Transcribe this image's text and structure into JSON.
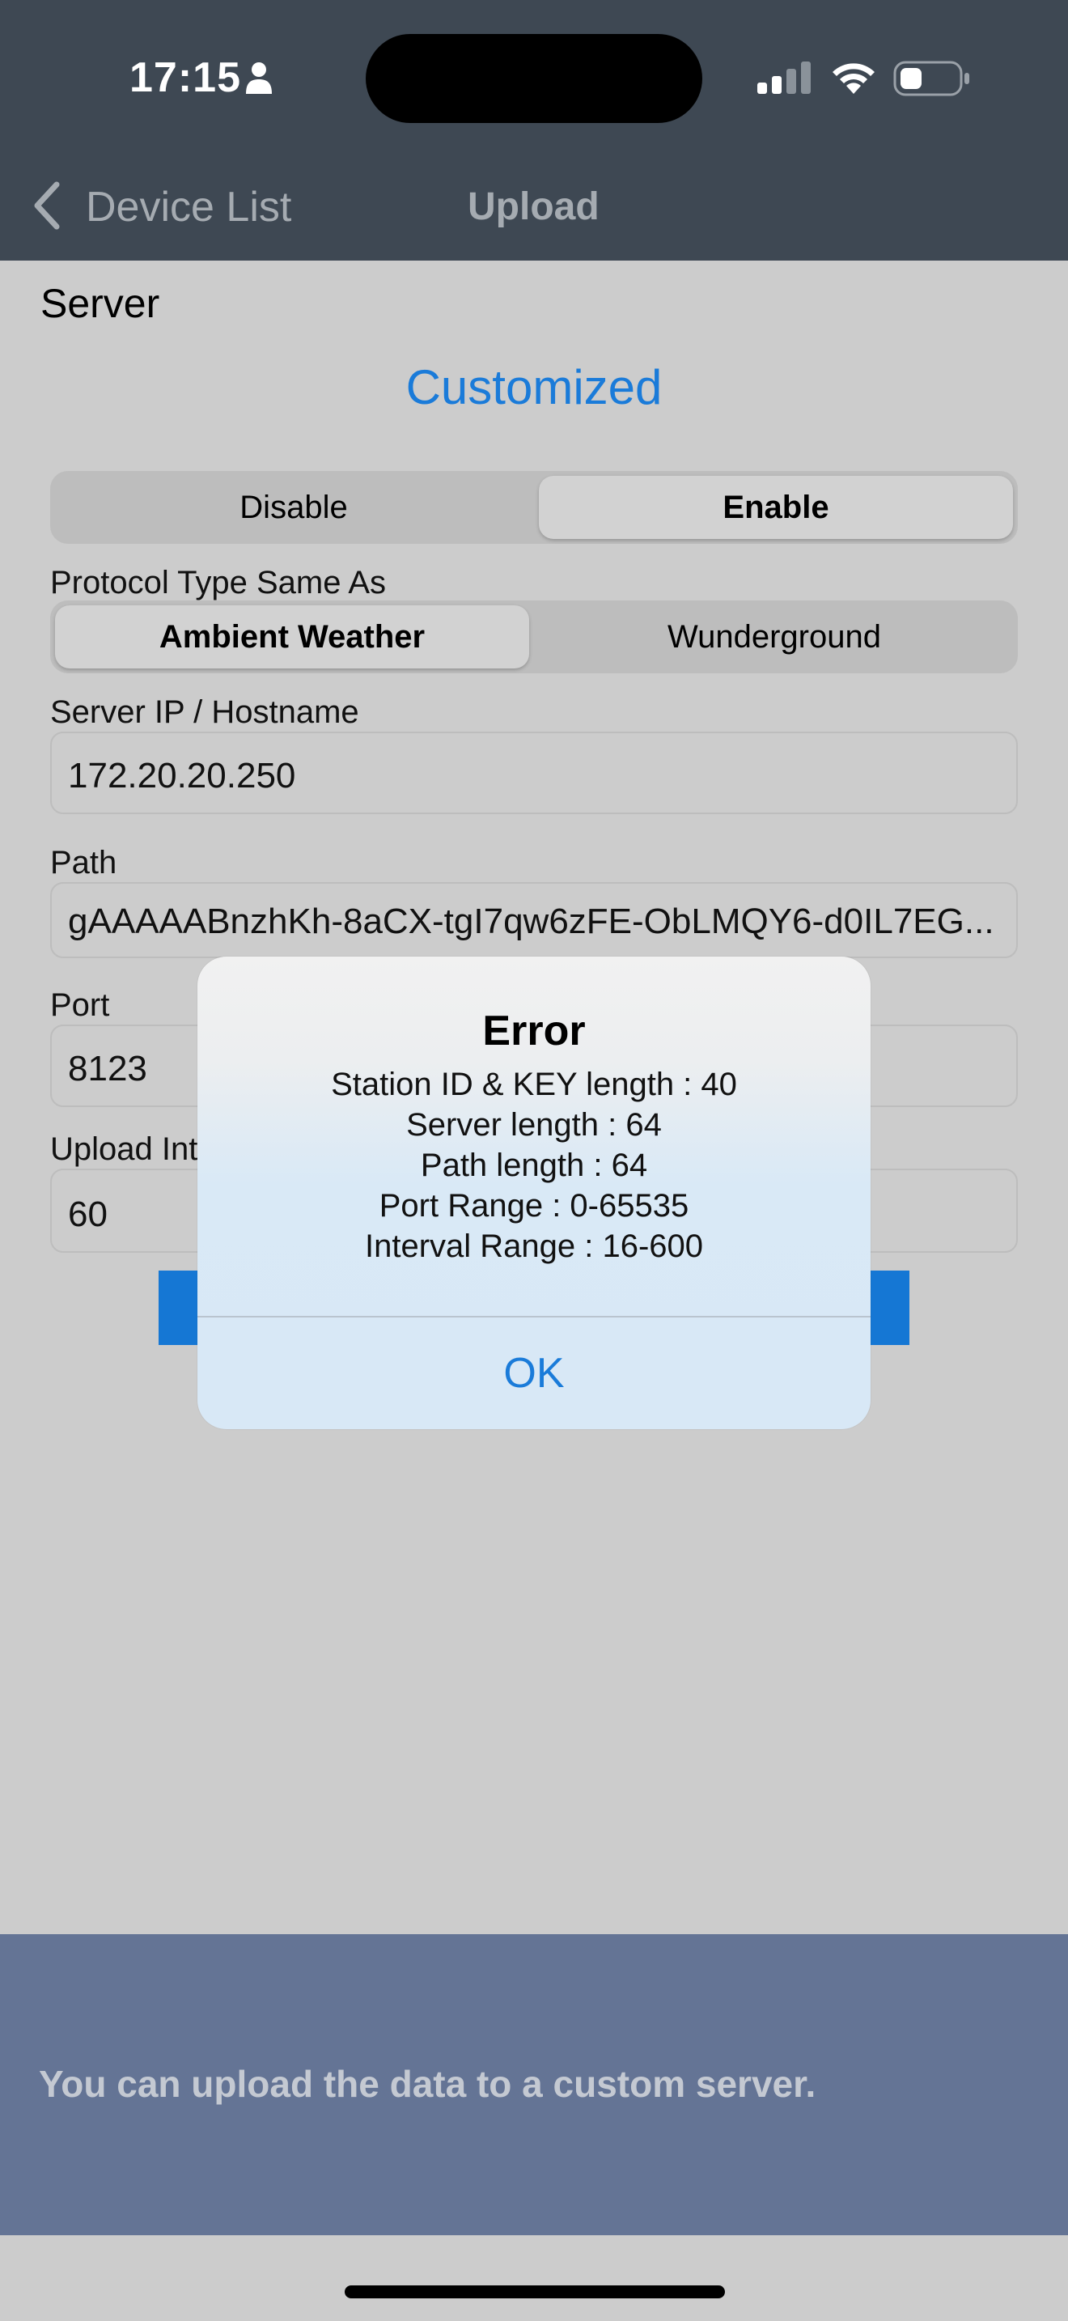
{
  "status_bar": {
    "time": "17:15",
    "icons": [
      "person-icon",
      "cellular-signal-icon",
      "wifi-icon",
      "battery-icon"
    ]
  },
  "nav": {
    "back_label": "Device List",
    "title": "Upload"
  },
  "section_title": "Server",
  "mode_label": "Customized",
  "enable_toggle": {
    "options": [
      "Disable",
      "Enable"
    ],
    "selected": "Enable"
  },
  "protocol": {
    "label": "Protocol Type Same As",
    "options": [
      "Ambient Weather",
      "Wunderground"
    ],
    "selected": "Ambient Weather"
  },
  "server_field": {
    "label": "Server IP / Hostname",
    "value": "172.20.20.250"
  },
  "path_field": {
    "label": "Path",
    "value": "gAAAAABnzhKh-8aCX-tgI7qw6zFE-ObLMQY6-d0IL7EG..."
  },
  "port_field": {
    "label": "Port",
    "value": "8123"
  },
  "interval_field": {
    "label": "Upload Int",
    "value": "60"
  },
  "info_text": "You can upload the data to a custom server.",
  "alert": {
    "title": "Error",
    "lines": [
      "Station ID & KEY length : 40",
      "Server length : 64",
      "Path length : 64",
      "Port Range : 0-65535",
      "Interval Range : 16-600"
    ],
    "ok_label": "OK"
  },
  "colors": {
    "accent": "#1a7bd9",
    "nav_bar": "#3e4853",
    "info_panel": "#647495"
  }
}
